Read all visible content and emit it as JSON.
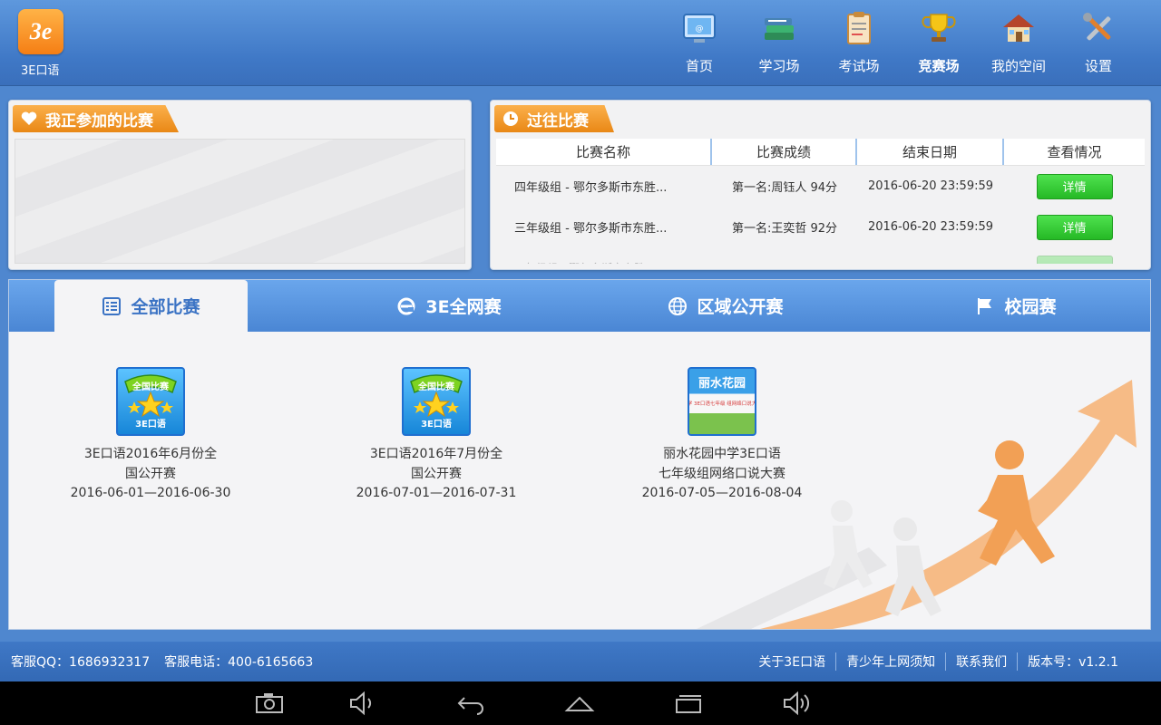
{
  "app": {
    "name": "3E口语",
    "logo_text": "3e"
  },
  "nav": [
    {
      "label": "首页",
      "icon": "monitor-icon",
      "active": false
    },
    {
      "label": "学习场",
      "icon": "books-icon",
      "active": false
    },
    {
      "label": "考试场",
      "icon": "clipboard-icon",
      "active": false
    },
    {
      "label": "竞赛场",
      "icon": "trophy-icon",
      "active": true
    },
    {
      "label": "我的空间",
      "icon": "house-icon",
      "active": false
    },
    {
      "label": "设置",
      "icon": "tools-icon",
      "active": false
    }
  ],
  "joined": {
    "title": "我正参加的比赛"
  },
  "past": {
    "title": "过往比赛",
    "headers": [
      "比赛名称",
      "比赛成绩",
      "结束日期",
      "查看情况"
    ],
    "rows": [
      {
        "name": "四年级组 - 鄂尔多斯市东胜...",
        "score": "第一名:周钰人 94分",
        "end": "2016-06-20 23:59:59",
        "action": "详情"
      },
      {
        "name": "三年级组 - 鄂尔多斯市东胜...",
        "score": "第一名:王奕哲 92分",
        "end": "2016-06-20 23:59:59",
        "action": "详情"
      }
    ]
  },
  "tabs": [
    {
      "label": "全部比赛",
      "icon": "list-icon",
      "active": true
    },
    {
      "label": "3E全网赛",
      "icon": "ie-icon",
      "active": false
    },
    {
      "label": "区域公开赛",
      "icon": "globe-icon",
      "active": false
    },
    {
      "label": "校园赛",
      "icon": "flag-icon",
      "active": false
    }
  ],
  "competitions": [
    {
      "thumb_text": "全国比赛",
      "thumb_sub": "3E口语",
      "line1": "3E口语2016年6月份全",
      "line2": "国公开赛",
      "dates": "2016-06-01—2016-06-30"
    },
    {
      "thumb_text": "全国比赛",
      "thumb_sub": "3E口语",
      "line1": "3E口语2016年7月份全",
      "line2": "国公开赛",
      "dates": "2016-07-01—2016-07-31"
    },
    {
      "thumb_text": "丽水花园",
      "thumb_sub": "中学 3E口语七年级 组网络口说大赛",
      "line1": "丽水花园中学3E口语",
      "line2": "七年级组网络口说大赛",
      "dates": "2016-07-05—2016-08-04"
    }
  ],
  "footer": {
    "qq": "客服QQ：1686932317",
    "phone": "客服电话：400-6165663",
    "links": [
      "关于3E口语",
      "青少年上网须知",
      "联系我们",
      "版本号：v1.2.1"
    ]
  }
}
